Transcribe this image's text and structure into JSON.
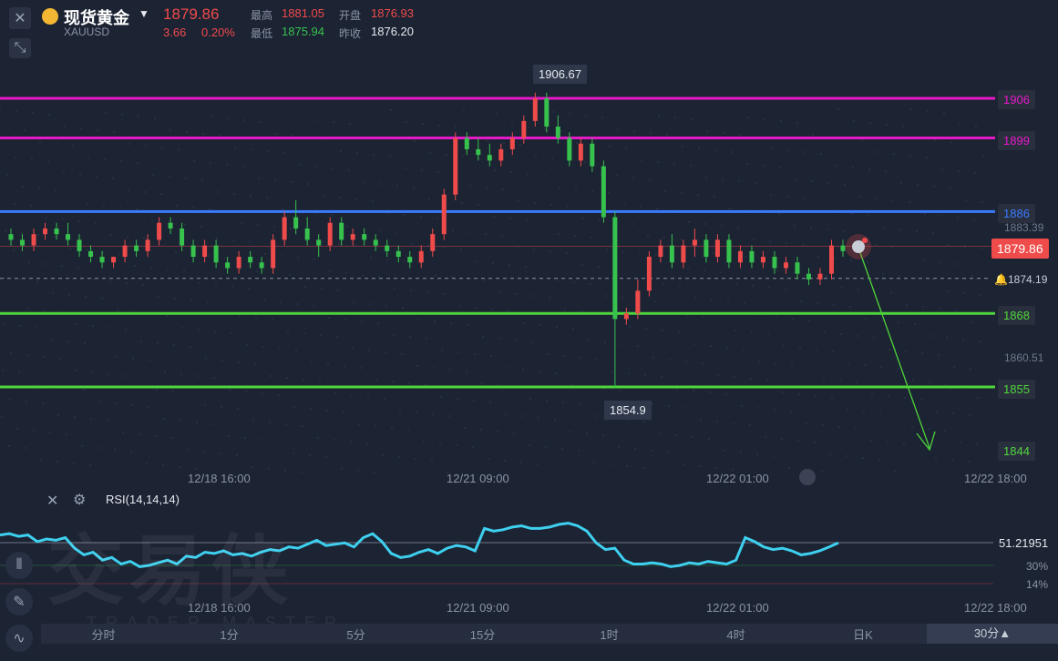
{
  "header": {
    "close_icon": "close-icon",
    "collapse_icon": "collapse-icon",
    "symbol_name": "现货黄金",
    "symbol_code": "XAUUSD",
    "last_price": "1879.86",
    "change": "3.66",
    "change_pct": "0.20%",
    "high_label": "最高",
    "high_value": "1881.05",
    "open_label": "开盘",
    "open_value": "1876.93",
    "low_label": "最低",
    "low_value": "1875.94",
    "prev_close_label": "昨收",
    "prev_close_value": "1876.20"
  },
  "colors": {
    "up": "#ef4b4b",
    "down": "#37c24d",
    "magenta_level": "#e619c8",
    "blue_level": "#3a7bff",
    "green_level": "#4fd63c",
    "rsi_line": "#3ed0ef"
  },
  "annotations": {
    "high_marker": "1906.67",
    "low_marker": "1854.9"
  },
  "levels": [
    {
      "label": "1906",
      "value": 1906,
      "color": "#e619c8"
    },
    {
      "label": "1899",
      "value": 1899,
      "color": "#e619c8"
    },
    {
      "label": "1886",
      "value": 1886,
      "color": "#3a7bff"
    },
    {
      "label": "1868",
      "value": 1868,
      "color": "#4fd63c"
    },
    {
      "label": "1855",
      "value": 1855,
      "color": "#4fd63c"
    },
    {
      "label": "1844",
      "value": 1844,
      "color": "#4fd63c"
    }
  ],
  "price_axis": {
    "current_price": "1879.86",
    "alert_price": "1874.19",
    "tick_1": "1883.39",
    "tick_2": "1860.51"
  },
  "time_axis": [
    "12/18 16:00",
    "12/21 09:00",
    "12/22 01:00",
    "12/22 18:00"
  ],
  "rsi": {
    "label": "RSI(14,14,14)",
    "value": "51.21951",
    "level_30": "30%",
    "level_14": "14%",
    "time_axis": [
      "12/18 16:00",
      "12/21 09:00",
      "12/22 01:00",
      "12/22 18:00"
    ]
  },
  "bottom_bar": {
    "tabs": [
      "分时",
      "1分",
      "5分",
      "15分",
      "1时",
      "4时",
      "日K"
    ],
    "selected": "30分▲"
  },
  "watermark": {
    "main": "交易侠",
    "sub": "TRADER MASTER"
  },
  "chart_data": {
    "type": "candlestick",
    "title": "现货黄金 XAUUSD",
    "ylim": [
      1842,
      1910
    ],
    "x_ticks": [
      "12/18 16:00",
      "12/21 09:00",
      "12/22 01:00",
      "12/22 18:00"
    ],
    "series": [
      {
        "name": "XAUUSD",
        "ohlc": [
          [
            1882,
            1883,
            1880,
            1881
          ],
          [
            1881,
            1882,
            1879,
            1880
          ],
          [
            1880,
            1883,
            1879,
            1882
          ],
          [
            1882,
            1884,
            1881,
            1883
          ],
          [
            1883,
            1884,
            1881,
            1882
          ],
          [
            1882,
            1884,
            1880,
            1881
          ],
          [
            1881,
            1882,
            1878,
            1879
          ],
          [
            1879,
            1880,
            1877,
            1878
          ],
          [
            1878,
            1879,
            1876,
            1877
          ],
          [
            1877,
            1878,
            1876,
            1878
          ],
          [
            1878,
            1881,
            1877,
            1880
          ],
          [
            1880,
            1881,
            1878,
            1879
          ],
          [
            1879,
            1882,
            1878,
            1881
          ],
          [
            1881,
            1885,
            1880,
            1884
          ],
          [
            1884,
            1885,
            1882,
            1883
          ],
          [
            1883,
            1884,
            1879,
            1880
          ],
          [
            1880,
            1881,
            1877,
            1878
          ],
          [
            1878,
            1881,
            1877,
            1880
          ],
          [
            1880,
            1881,
            1876,
            1877
          ],
          [
            1877,
            1878,
            1875,
            1876
          ],
          [
            1876,
            1879,
            1875,
            1878
          ],
          [
            1878,
            1879,
            1876,
            1877
          ],
          [
            1877,
            1878,
            1875,
            1876
          ],
          [
            1876,
            1882,
            1875,
            1881
          ],
          [
            1881,
            1886,
            1880,
            1885
          ],
          [
            1885,
            1888,
            1882,
            1883
          ],
          [
            1883,
            1885,
            1880,
            1881
          ],
          [
            1881,
            1882,
            1878,
            1880
          ],
          [
            1880,
            1885,
            1879,
            1884
          ],
          [
            1884,
            1885,
            1880,
            1881
          ],
          [
            1881,
            1883,
            1880,
            1882
          ],
          [
            1882,
            1883,
            1880,
            1881
          ],
          [
            1881,
            1882,
            1879,
            1880
          ],
          [
            1880,
            1881,
            1878,
            1879
          ],
          [
            1879,
            1880,
            1877,
            1878
          ],
          [
            1878,
            1879,
            1876,
            1877
          ],
          [
            1877,
            1880,
            1876,
            1879
          ],
          [
            1879,
            1883,
            1878,
            1882
          ],
          [
            1882,
            1890,
            1881,
            1889
          ],
          [
            1889,
            1900,
            1888,
            1899
          ],
          [
            1899,
            1900,
            1896,
            1897
          ],
          [
            1897,
            1899,
            1895,
            1896
          ],
          [
            1896,
            1898,
            1894,
            1895
          ],
          [
            1895,
            1898,
            1894,
            1897
          ],
          [
            1897,
            1900,
            1896,
            1899
          ],
          [
            1899,
            1903,
            1898,
            1902
          ],
          [
            1902,
            1907,
            1901,
            1906
          ],
          [
            1906,
            1907,
            1900,
            1901
          ],
          [
            1901,
            1903,
            1898,
            1899
          ],
          [
            1899,
            1900,
            1894,
            1895
          ],
          [
            1895,
            1899,
            1894,
            1898
          ],
          [
            1898,
            1899,
            1893,
            1894
          ],
          [
            1894,
            1895,
            1884,
            1885
          ],
          [
            1885,
            1886,
            1854.9,
            1867
          ],
          [
            1867,
            1869,
            1866,
            1868
          ],
          [
            1868,
            1874,
            1867,
            1872
          ],
          [
            1872,
            1879,
            1871,
            1878
          ],
          [
            1878,
            1881,
            1877,
            1880
          ],
          [
            1880,
            1882,
            1876,
            1877
          ],
          [
            1877,
            1881,
            1876,
            1880
          ],
          [
            1880,
            1883,
            1878,
            1881
          ],
          [
            1881,
            1882,
            1877,
            1878
          ],
          [
            1878,
            1882,
            1877,
            1881
          ],
          [
            1881,
            1882,
            1876,
            1877
          ],
          [
            1877,
            1880,
            1876,
            1879
          ],
          [
            1879,
            1880,
            1876,
            1877
          ],
          [
            1877,
            1879,
            1876,
            1878
          ],
          [
            1878,
            1879,
            1875,
            1876
          ],
          [
            1876,
            1878,
            1875,
            1877
          ],
          [
            1877,
            1878,
            1874,
            1875
          ],
          [
            1875,
            1876,
            1873,
            1874
          ],
          [
            1874,
            1876,
            1873,
            1875
          ],
          [
            1875,
            1881,
            1874,
            1880
          ],
          [
            1880,
            1881,
            1878,
            1879
          ]
        ]
      }
    ],
    "rsi_values": [
      57,
      58,
      56,
      57,
      52,
      54,
      53,
      55,
      47,
      42,
      44,
      38,
      40,
      35,
      37,
      33,
      34,
      36,
      38,
      35,
      41,
      40,
      44,
      43,
      45,
      42,
      43,
      41,
      44,
      46,
      45,
      48,
      47,
      50,
      53,
      49,
      50,
      51,
      48,
      55,
      58,
      52,
      43,
      40,
      41,
      44,
      46,
      43,
      47,
      49,
      48,
      45,
      62,
      60,
      61,
      63,
      64,
      62,
      62,
      63,
      65,
      66,
      64,
      60,
      51,
      46,
      47,
      38,
      35,
      35,
      36,
      35,
      33,
      34,
      36,
      35,
      37,
      36,
      35,
      38,
      55,
      52,
      48,
      46,
      47,
      45,
      42,
      43,
      45,
      48,
      51
    ]
  }
}
